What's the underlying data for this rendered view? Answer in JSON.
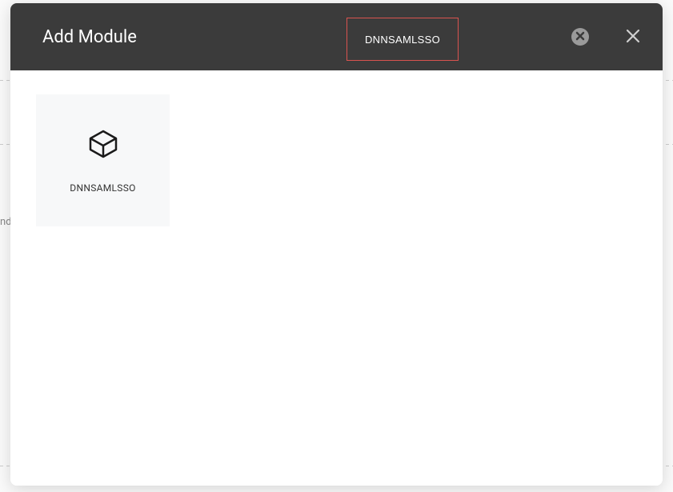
{
  "modal": {
    "title": "Add Module",
    "search_value": "DNNSAMLSSO"
  },
  "modules": [
    {
      "label": "DNNSAMLSSO",
      "icon": "package-icon"
    }
  ],
  "background": {
    "partial_text": "nd"
  }
}
